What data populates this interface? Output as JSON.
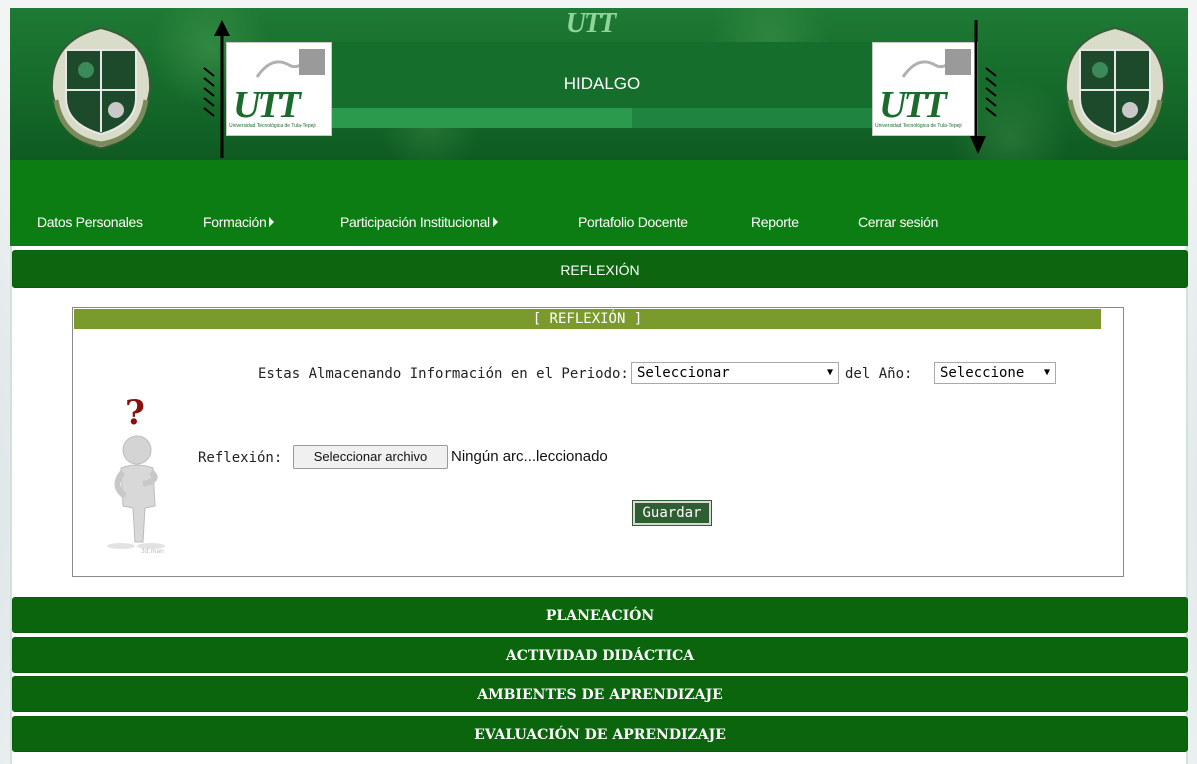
{
  "header": {
    "brand_top": "UTT",
    "title": "HIDALGO",
    "logo_text": "UTT",
    "logo_subtitle": "Universidad Tecnológica de Tula-Tepeji"
  },
  "nav": {
    "items": [
      {
        "label": "Datos Personales",
        "has_submenu": false
      },
      {
        "label": "Formación",
        "has_submenu": true
      },
      {
        "label": "Participación Institucional",
        "has_submenu": true
      },
      {
        "label": "Portafolio Docente",
        "has_submenu": false
      },
      {
        "label": "Reporte",
        "has_submenu": false
      },
      {
        "label": "Cerrar sesión",
        "has_submenu": false
      }
    ]
  },
  "accordion": {
    "active": "REFLEXIÓN",
    "others": [
      "PLANEACIÓN",
      "ACTIVIDAD DIDÁCTICA",
      "AMBIENTES DE APRENDIZAJE",
      "EVALUACIÓN DE APRENDIZAJE"
    ]
  },
  "form": {
    "section_title": "[ REFLEXIÓN ]",
    "periodo_label": "Estas Almacenando Información en el Periodo:",
    "periodo_value": "Seleccionar",
    "anio_label": "del Año:",
    "anio_value": "Seleccione",
    "reflexion_label": "Reflexión:",
    "file_button": "Seleccionar archivo",
    "file_status": "Ningún arc...leccionado",
    "save_button": "Guardar",
    "figure_watermark": "3d.man"
  },
  "colors": {
    "nav_green": "#0b7d12",
    "accordion_green": "#0b650d",
    "section_olive": "#7a9a2e",
    "save_green": "#2f5e33"
  }
}
